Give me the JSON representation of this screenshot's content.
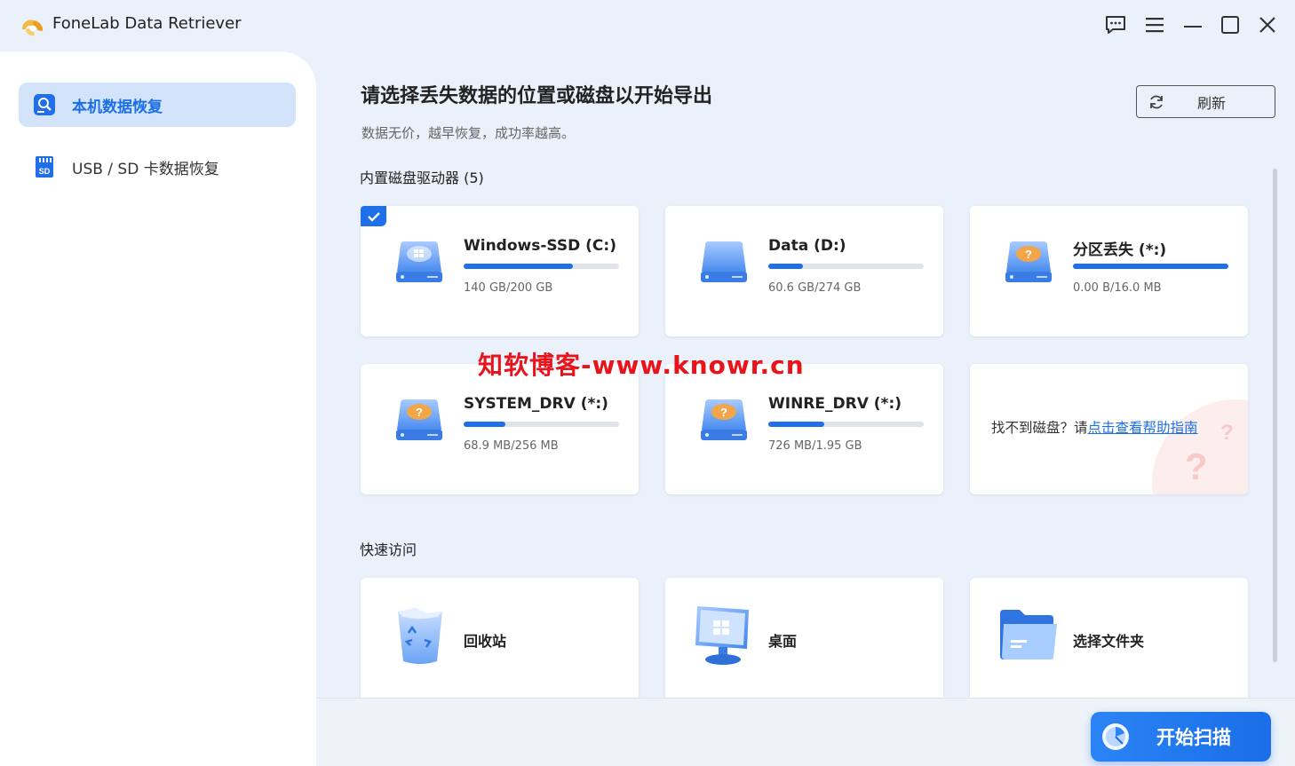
{
  "app": {
    "title": "FoneLab Data Retriever"
  },
  "colors": {
    "accent": "#1f6fe8",
    "sidebar_active_bg": "#d3e3f9",
    "background": "#eaf1fb",
    "watermark": "#e8141c"
  },
  "sidebar": {
    "items": [
      {
        "label": "本机数据恢复",
        "icon": "pc-recovery-icon",
        "active": true
      },
      {
        "label": "USB / SD 卡数据恢复",
        "icon": "sd-card-icon",
        "active": false
      }
    ]
  },
  "main": {
    "title": "请选择丢失数据的位置或磁盘以开始导出",
    "subtitle": "数据无价，越早恢复，成功率越高。",
    "refresh_label": "刷新",
    "drives_section": "内置磁盘驱动器 (5)",
    "drives": [
      {
        "name": "Windows-SSD (C:)",
        "size": "140 GB/200 GB",
        "fill": 0.7,
        "icon": "windows-drive-icon",
        "selected": true
      },
      {
        "name": "Data (D:)",
        "size": "60.6 GB/274 GB",
        "fill": 0.22,
        "icon": "drive-icon",
        "selected": false
      },
      {
        "name": "分区丢失 (*:)",
        "size": "0.00  B/16.0 MB",
        "fill": 1.0,
        "icon": "unknown-drive-icon",
        "selected": false
      },
      {
        "name": "SYSTEM_DRV (*:)",
        "size": "68.9 MB/256 MB",
        "fill": 0.27,
        "icon": "unknown-drive-icon",
        "selected": false
      },
      {
        "name": "WINRE_DRV (*:)",
        "size": "726 MB/1.95 GB",
        "fill": 0.36,
        "icon": "unknown-drive-icon",
        "selected": false
      }
    ],
    "help": {
      "prefix": "找不到磁盘？请",
      "link": "点击查看帮助指南"
    },
    "quick_section": "快速访问",
    "quick": [
      {
        "label": "回收站",
        "icon": "recycle-bin-icon"
      },
      {
        "label": "桌面",
        "icon": "desktop-icon"
      },
      {
        "label": "选择文件夹",
        "icon": "folder-icon"
      }
    ],
    "scan_label": "开始扫描"
  },
  "watermark": "知软博客-www.knowr.cn"
}
